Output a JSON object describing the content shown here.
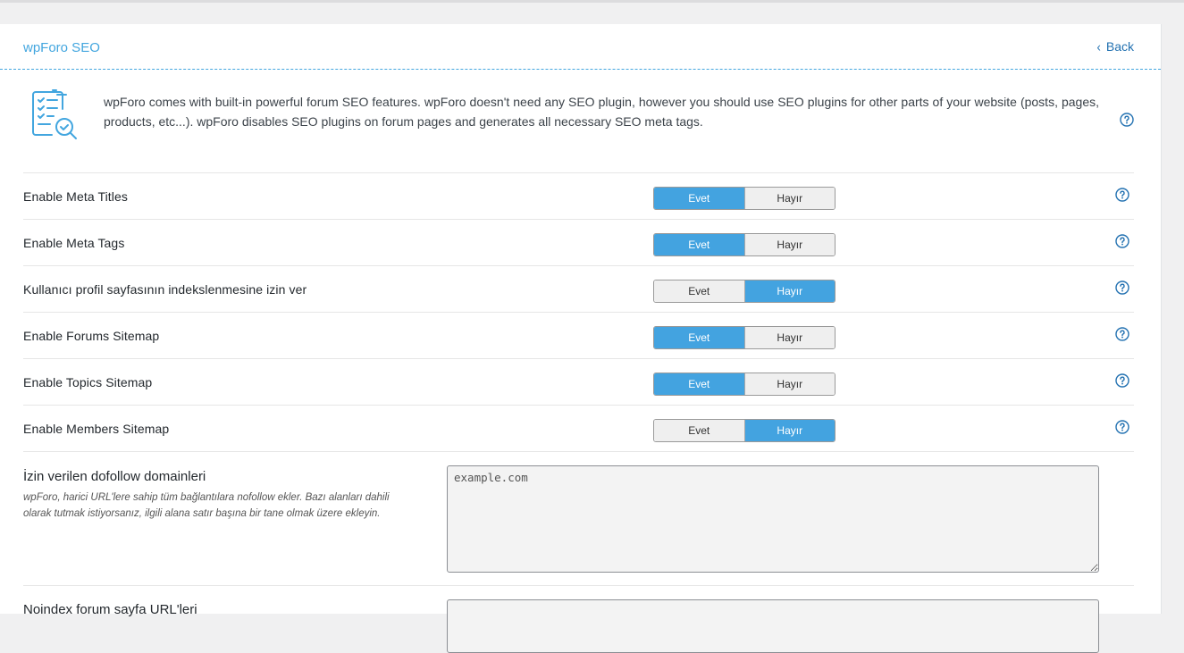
{
  "header": {
    "title": "wpForo SEO",
    "back_label": "Back"
  },
  "intro": {
    "icon": "seo-checklist-icon",
    "text": "wpForo comes with built-in powerful forum SEO features. wpForo doesn't need any SEO plugin, however you should use SEO plugins for other parts of your website (posts, pages, products, etc...). wpForo disables SEO plugins on forum pages and generates all necessary SEO meta tags."
  },
  "toggle_labels": {
    "yes": "Evet",
    "no": "Hayır"
  },
  "settings": [
    {
      "label": "Enable Meta Titles",
      "value": "Evet"
    },
    {
      "label": "Enable Meta Tags",
      "value": "Evet"
    },
    {
      "label": "Kullanıcı profil sayfasının indekslenmesine izin ver",
      "value": "Hayır"
    },
    {
      "label": "Enable Forums Sitemap",
      "value": "Evet"
    },
    {
      "label": "Enable Topics Sitemap",
      "value": "Evet"
    },
    {
      "label": "Enable Members Sitemap",
      "value": "Hayır"
    }
  ],
  "dofollow": {
    "title": "İzin verilen dofollow domainleri",
    "description": "wpForo, harici URL'lere sahip tüm bağlantılara nofollow ekler. Bazı alanları dahili olarak tutmak istiyorsanız, ilgili alana satır başına bir tane olmak üzere ekleyin.",
    "value": "example.com"
  },
  "next_setting": {
    "title": "Noindex forum sayfa URL'leri"
  },
  "colors": {
    "accent": "#43a6df",
    "toggle_on": "#43a3e0",
    "toggle_off": "#efefef"
  }
}
